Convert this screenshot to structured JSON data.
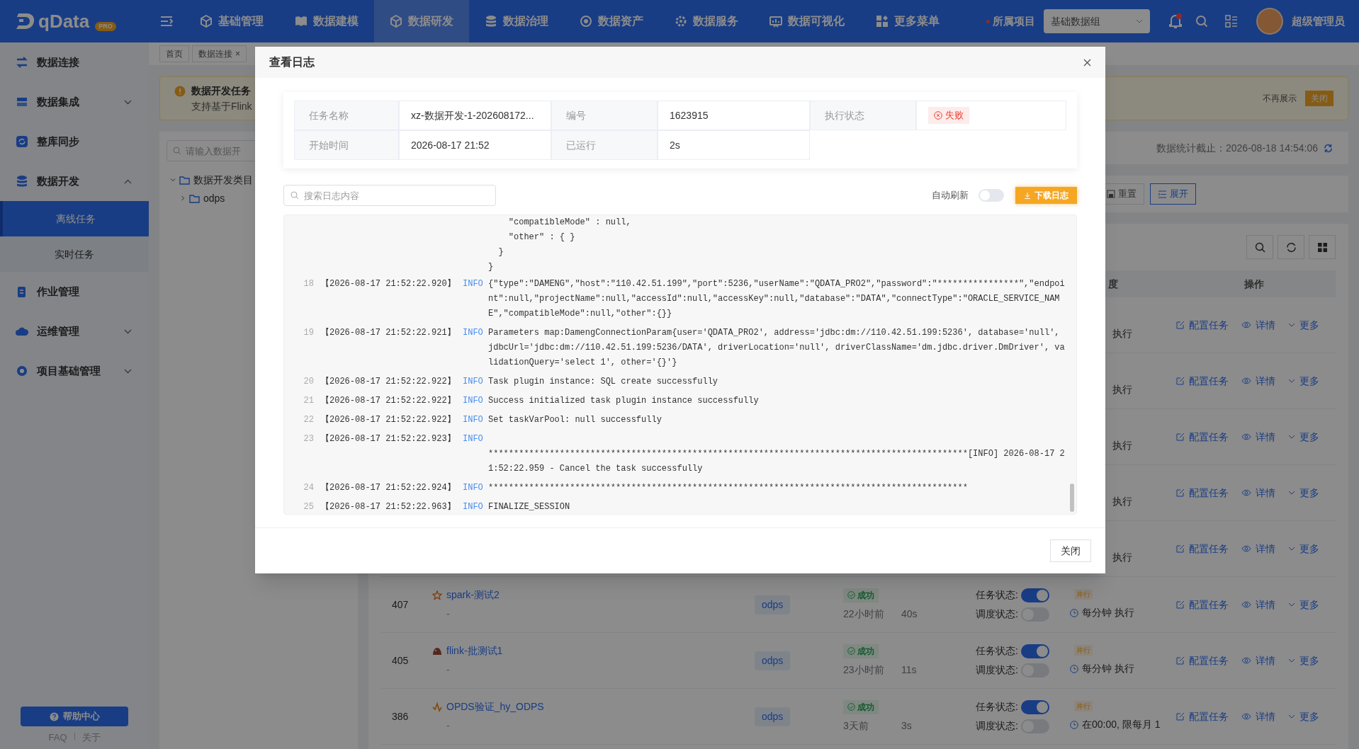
{
  "top_nav": {
    "logo": "qData",
    "logo_badge": "PRO",
    "items": [
      {
        "label": "基础管理",
        "selected": false
      },
      {
        "label": "数据建模",
        "selected": false
      },
      {
        "label": "数据研发",
        "selected": true
      },
      {
        "label": "数据治理",
        "selected": false
      },
      {
        "label": "数据资产",
        "selected": false
      },
      {
        "label": "数据服务",
        "selected": false
      },
      {
        "label": "数据可视化",
        "selected": false
      },
      {
        "label": "更多菜单",
        "selected": false
      }
    ],
    "project_label": "所属项目",
    "project": "基础数据组",
    "user": "超级管理员"
  },
  "sidebar": {
    "items": [
      {
        "label": "数据连接",
        "kind": "link"
      },
      {
        "label": "数据集成",
        "kind": "group",
        "expanded": false
      },
      {
        "label": "整库同步",
        "kind": "link"
      },
      {
        "label": "数据开发",
        "kind": "group",
        "expanded": true,
        "children": [
          {
            "label": "离线任务",
            "selected": true
          },
          {
            "label": "实时任务",
            "selected": false
          }
        ]
      },
      {
        "label": "作业管理",
        "kind": "link"
      },
      {
        "label": "运维管理",
        "kind": "group",
        "expanded": false
      },
      {
        "label": "项目基础管理",
        "kind": "group",
        "expanded": false
      }
    ],
    "help_button": "帮助中心",
    "footer_links": [
      "FAQ",
      "关于"
    ]
  },
  "tabs": [
    {
      "label": "首页"
    },
    {
      "label": "数据连接",
      "close": "×"
    }
  ],
  "notice": {
    "title": "数据开发任务",
    "text": "支持基于Flink",
    "dismiss": "不再展示",
    "close_button": "关闭"
  },
  "tree": {
    "placeholder": "请输入数据开",
    "nodes": [
      {
        "label": "数据开发类目",
        "expanded": true,
        "children": [
          {
            "label": "odps",
            "expanded": false
          }
        ]
      }
    ]
  },
  "stats": {
    "text": "数据统计截止：2026-08-18 14:54:06"
  },
  "filter_buttons": [
    "重置",
    "展开"
  ],
  "table": {
    "columns": [
      "度",
      "操作"
    ],
    "rows": [
      {
        "kind": "partial",
        "schedule": "执行",
        "actions": [
          "配置任务",
          "详情",
          "更多"
        ]
      },
      {
        "kind": "partial",
        "schedule": "执行",
        "actions": [
          "配置任务",
          "详情",
          "更多"
        ]
      },
      {
        "kind": "partial",
        "schedule": "执行",
        "actions": [
          "配置任务",
          "详情",
          "更多"
        ]
      },
      {
        "kind": "partial",
        "schedule": "执行",
        "actions": [
          "配置任务",
          "详情",
          "更多"
        ]
      },
      {
        "kind": "partial",
        "schedule": "执行",
        "actions": [
          "配置任务",
          "详情",
          "更多"
        ]
      },
      {
        "kind": "full",
        "id": "407",
        "name": "spark-测试2",
        "description": "-",
        "type": "odps",
        "status": "成功",
        "last_run": "22小时前",
        "duration": "40s",
        "task_label": "任务状态:",
        "task_on": true,
        "dispatch_label": "调度状态:",
        "dispatch_on": false,
        "mode": "并行",
        "schedule": "每分钟 执行",
        "actions": [
          "配置任务",
          "详情",
          "更多"
        ]
      },
      {
        "kind": "full",
        "id": "405",
        "name": "flink-批测试1",
        "description": "-",
        "type": "odps",
        "status": "成功",
        "last_run": "23小时前",
        "duration": "11s",
        "task_label": "任务状态:",
        "task_on": true,
        "dispatch_label": "调度状态:",
        "dispatch_on": false,
        "mode": "并行",
        "schedule": "每分钟 执行",
        "actions": [
          "配置任务",
          "详情",
          "更多"
        ]
      },
      {
        "kind": "full",
        "id": "386",
        "name": "OPDS验证_hy_ODPS",
        "description": "-",
        "type": "odps",
        "status": "成功",
        "last_run": "3天前",
        "duration": "3s",
        "task_label": "任务状态:",
        "task_on": true,
        "dispatch_label": "调度状态:",
        "dispatch_on": false,
        "mode": "并行",
        "schedule": "在00:00, 限每月 1",
        "actions": [
          "配置任务",
          "详情",
          "更多"
        ]
      }
    ]
  },
  "modal": {
    "title": "查看日志",
    "info": [
      {
        "label": "任务名称",
        "value": "xz-数据开发-1-202608172...",
        "kind": "text"
      },
      {
        "label": "编号",
        "value": "1623915",
        "kind": "text"
      },
      {
        "label": "执行状态",
        "value": "失败",
        "kind": "status"
      },
      {
        "label": "开始时间",
        "value": "2026-08-17 21:52",
        "kind": "text"
      },
      {
        "label": "已运行",
        "value": "2s",
        "kind": "text"
      }
    ],
    "search_placeholder": "搜索日志内容",
    "auto_refresh_label": "自动刷新",
    "auto_refresh_on": false,
    "download_button": "下载日志",
    "log_lines": [
      {
        "kind": "continuation",
        "text": "    \"compatibleMode\" : null,"
      },
      {
        "kind": "continuation",
        "text": "    \"other\" : { }"
      },
      {
        "kind": "continuation",
        "text": "  }"
      },
      {
        "kind": "continuation",
        "text": "}"
      },
      {
        "kind": "entry",
        "number": "18",
        "time": "【2026-08-17 21:52:22.920】",
        "level": "INFO",
        "message": "{\"type\":\"DAMENG\",\"host\":\"110.42.51.199\",\"port\":5236,\"userName\":\"QDATA_PRO2\",\"password\":\"****************\",\"endpoint\":null,\"projectName\":null,\"accessId\":null,\"accessKey\":null,\"database\":\"DATA\",\"connectType\":\"ORACLE_SERVICE_NAME\",\"compatibleMode\":null,\"other\":{}}"
      },
      {
        "kind": "entry",
        "number": "19",
        "time": "【2026-08-17 21:52:22.921】",
        "level": "INFO",
        "message": "Parameters map:DamengConnectionParam{user='QDATA_PRO2', address='jdbc:dm://110.42.51.199:5236', database='null', jdbcUrl='jdbc:dm://110.42.51.199:5236/DATA', driverLocation='null', driverClassName='dm.jdbc.driver.DmDriver', validationQuery='select 1', other='{}'}"
      },
      {
        "kind": "entry",
        "number": "20",
        "time": "【2026-08-17 21:52:22.922】",
        "level": "INFO",
        "message": "Task plugin instance: SQL create successfully"
      },
      {
        "kind": "entry",
        "number": "21",
        "time": "【2026-08-17 21:52:22.922】",
        "level": "INFO",
        "message": "Success initialized task plugin instance successfully"
      },
      {
        "kind": "entry",
        "number": "22",
        "time": "【2026-08-17 21:52:22.922】",
        "level": "INFO",
        "message": "Set taskVarPool: null successfully"
      },
      {
        "kind": "entry",
        "number": "23",
        "time": "【2026-08-17 21:52:22.923】",
        "level": "INFO",
        "message": "\n**********************************************************************************************[INFO] 2026-08-17 21:52:22.959 - Cancel the task successfully"
      },
      {
        "kind": "entry",
        "number": "24",
        "time": "【2026-08-17 21:52:22.924】",
        "level": "INFO",
        "message": "**********************************************************************************************"
      },
      {
        "kind": "entry",
        "number": "25",
        "time": "【2026-08-17 21:52:22.963】",
        "level": "INFO",
        "message": "FINALIZE_SESSION"
      }
    ],
    "footer_button": "关闭"
  }
}
